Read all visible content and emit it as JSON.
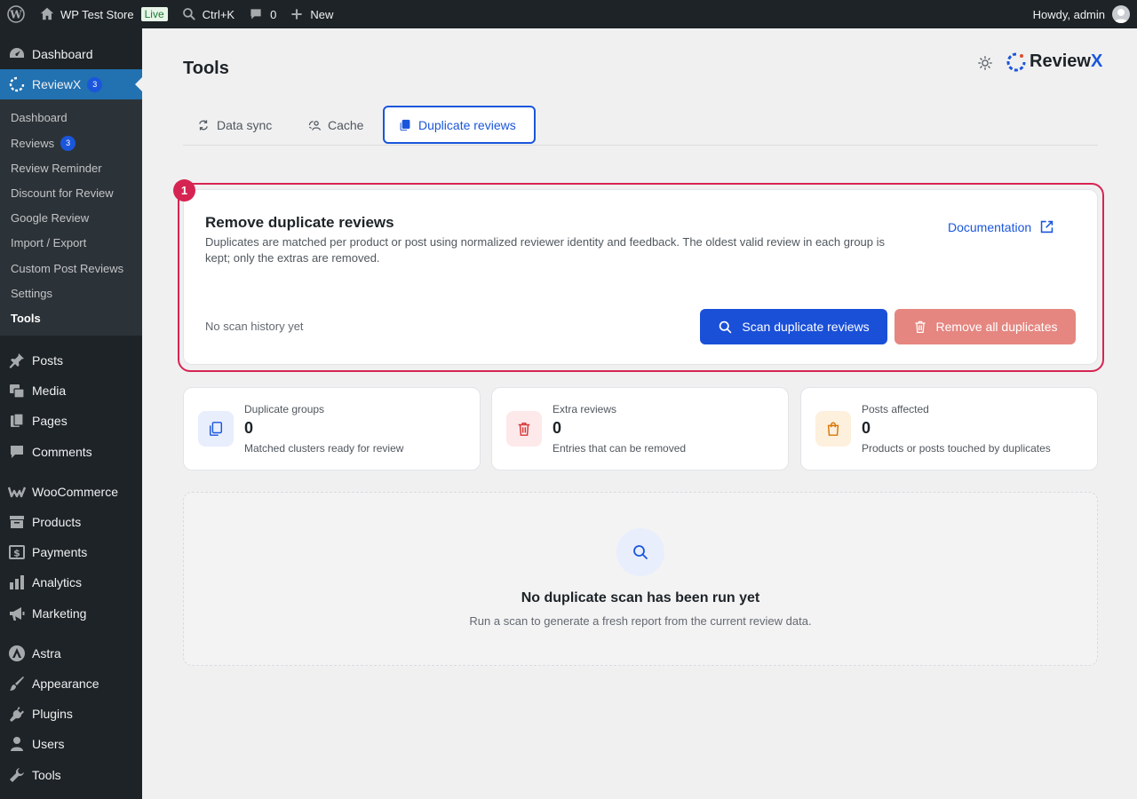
{
  "admin_bar": {
    "site_name": "WP Test Store",
    "live_label": "Live",
    "search_shortcut": "Ctrl+K",
    "comments_count": "0",
    "new_label": "New",
    "greeting": "Howdy, admin"
  },
  "sidebar": {
    "top_items": [
      {
        "label": "Dashboard",
        "icon": "dashboard-icon"
      },
      {
        "label": "ReviewX",
        "icon": "reviewx-icon",
        "badge": "3"
      }
    ],
    "submenu": [
      {
        "label": "Dashboard"
      },
      {
        "label": "Reviews",
        "badge": "3"
      },
      {
        "label": "Review Reminder"
      },
      {
        "label": "Discount for Review"
      },
      {
        "label": "Google Review"
      },
      {
        "label": "Import / Export"
      },
      {
        "label": "Custom Post Reviews"
      },
      {
        "label": "Settings"
      },
      {
        "label": "Tools"
      }
    ],
    "items": [
      {
        "label": "Posts",
        "icon": "pin-icon"
      },
      {
        "label": "Media",
        "icon": "media-icon"
      },
      {
        "label": "Pages",
        "icon": "pages-icon"
      },
      {
        "label": "Comments",
        "icon": "comment-icon"
      },
      {
        "label": "WooCommerce",
        "icon": "woocommerce-icon"
      },
      {
        "label": "Products",
        "icon": "archive-icon"
      },
      {
        "label": "Payments",
        "icon": "payments-icon"
      },
      {
        "label": "Analytics",
        "icon": "analytics-icon"
      },
      {
        "label": "Marketing",
        "icon": "megaphone-icon"
      },
      {
        "label": "Astra",
        "icon": "astra-icon"
      },
      {
        "label": "Appearance",
        "icon": "brush-icon"
      },
      {
        "label": "Plugins",
        "icon": "plugin-icon"
      },
      {
        "label": "Users",
        "icon": "user-icon"
      },
      {
        "label": "Tools",
        "icon": "wrench-icon"
      }
    ]
  },
  "page": {
    "title": "Tools",
    "logo_text": "Review",
    "logo_accent": "X"
  },
  "tabs": [
    {
      "label": "Data sync",
      "icon": "sync-icon"
    },
    {
      "label": "Cache",
      "icon": "cache-icon"
    },
    {
      "label": "Duplicate reviews",
      "icon": "copy-icon",
      "active": true
    }
  ],
  "annotation": {
    "marker": "1"
  },
  "duplicates_card": {
    "title": "Remove duplicate reviews",
    "description": "Duplicates are matched per product or post using normalized reviewer identity and feedback. The oldest valid review in each group is kept; only the extras are removed.",
    "documentation_label": "Documentation",
    "status": "No scan history yet",
    "scan_button": "Scan duplicate reviews",
    "remove_button": "Remove all duplicates"
  },
  "stats": [
    {
      "label": "Duplicate groups",
      "value": "0",
      "desc": "Matched clusters ready for review",
      "icon": "copy-icon",
      "color": "#1a56db",
      "bg": "#e8eefc"
    },
    {
      "label": "Extra reviews",
      "value": "0",
      "desc": "Entries that can be removed",
      "icon": "trash-icon",
      "color": "#d63638",
      "bg": "#fde8ea"
    },
    {
      "label": "Posts affected",
      "value": "0",
      "desc": "Products or posts touched by duplicates",
      "icon": "bag-icon",
      "color": "#d97706",
      "bg": "#fdf0dd"
    }
  ],
  "empty_state": {
    "title": "No duplicate scan has been run yet",
    "description": "Run a scan to generate a fresh report from the current review data."
  },
  "colors": {
    "accent": "#1a56db",
    "highlight": "#d62452",
    "remove_button": "#e58680",
    "wp_dark": "#1d2327"
  }
}
